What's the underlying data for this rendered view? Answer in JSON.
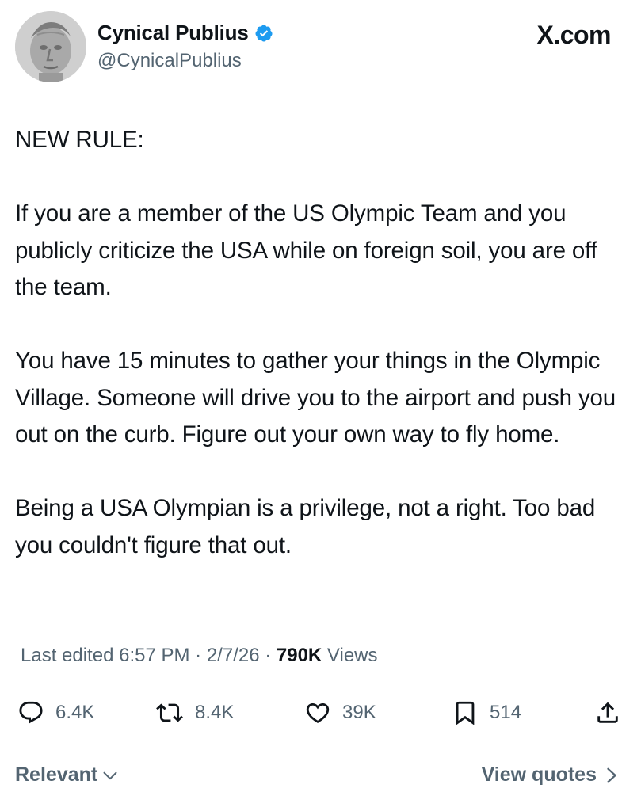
{
  "author": {
    "display_name": "Cynical Publius",
    "handle": "@CynicalPublius",
    "verified": true,
    "avatar_icon": "marble-bust-avatar"
  },
  "site_label": "X.com",
  "tweet": {
    "paragraphs": [
      "NEW RULE:",
      "If you are a member of the US Olympic Team and you publicly criticize the USA while on foreign soil, you are off the team.",
      "You have 15 minutes to gather your things in the Olympic Village.  Someone will drive you to the airport and push you out on the curb.  Figure out your own way to fly home.",
      "Being a USA Olympian is a privilege, not a right. Too bad you couldn't figure that out."
    ]
  },
  "meta": {
    "edited_label": "Last edited",
    "time": "6:57 PM",
    "date": "2/7/26",
    "separator": " · ",
    "views_count": "790K",
    "views_label": "Views"
  },
  "actions": {
    "replies": "6.4K",
    "reposts": "8.4K",
    "likes": "39K",
    "bookmarks": "514"
  },
  "footer": {
    "sort_label": "Relevant",
    "view_quotes_label": "View quotes"
  },
  "colors": {
    "text": "#0f1419",
    "secondary": "#536471",
    "verified": "#1d9bf0"
  }
}
